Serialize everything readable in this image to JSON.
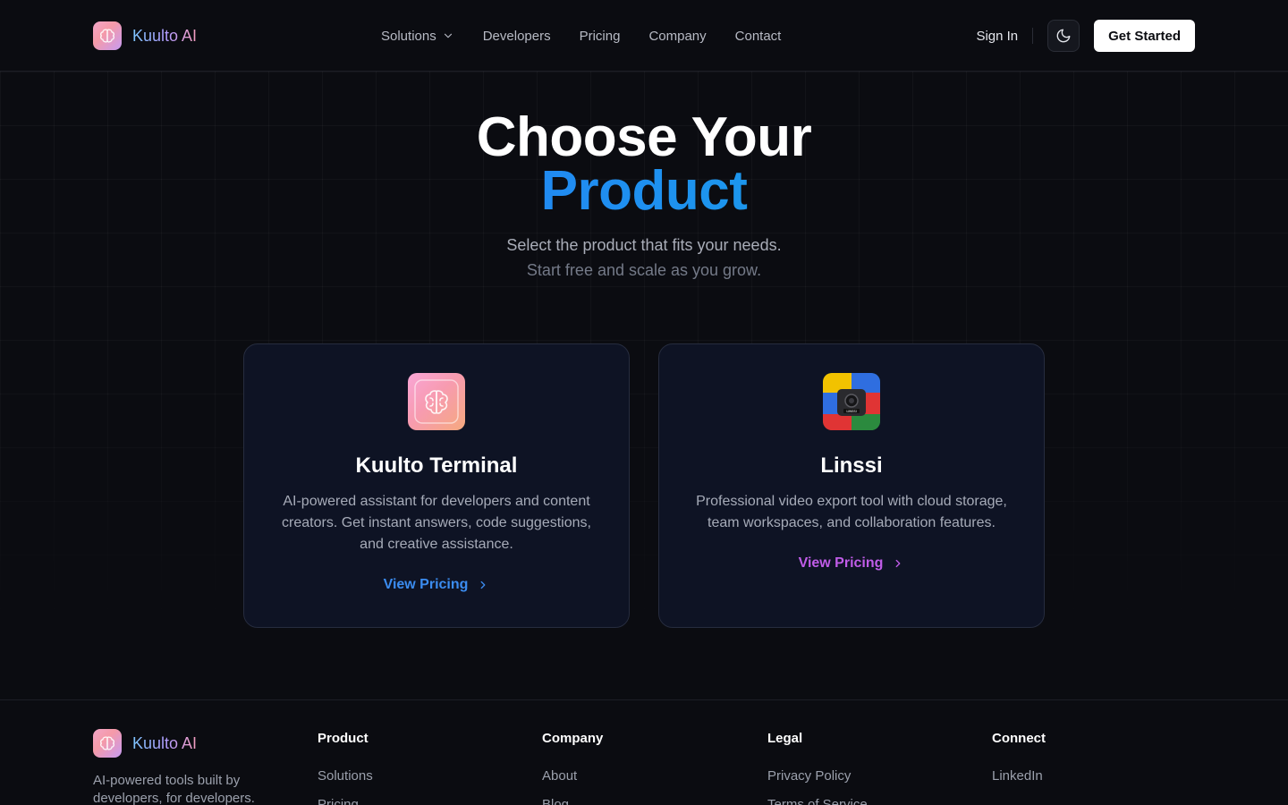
{
  "header": {
    "brand": "Kuulto AI",
    "nav": [
      {
        "label": "Solutions",
        "has_dropdown": true
      },
      {
        "label": "Developers"
      },
      {
        "label": "Pricing"
      },
      {
        "label": "Company"
      },
      {
        "label": "Contact"
      }
    ],
    "sign_in": "Sign In",
    "theme_icon": "moon-icon",
    "cta": "Get Started"
  },
  "hero": {
    "title_line1": "Choose Your",
    "title_line2": "Product",
    "subtitle_line1": "Select the product that fits your needs.",
    "subtitle_line2": "Start free and scale as you grow."
  },
  "products": [
    {
      "name": "Kuulto Terminal",
      "icon": "brain-icon",
      "description": "AI-powered assistant for developers and content creators. Get instant answers, code suggestions, and creative assistance.",
      "link": "View Pricing",
      "accent": "#3b8cf0"
    },
    {
      "name": "Linssi",
      "icon": "camera-icon",
      "icon_badge": "LINSSI",
      "description": "Professional video export tool with cloud storage, team workspaces, and collaboration features.",
      "link": "View Pricing",
      "accent": "#c05ce8"
    }
  ],
  "footer": {
    "brand": "Kuulto AI",
    "tagline": "AI-powered tools built by developers, for developers.",
    "columns": [
      {
        "heading": "Product",
        "links": [
          "Solutions",
          "Pricing"
        ]
      },
      {
        "heading": "Company",
        "links": [
          "About",
          "Blog"
        ]
      },
      {
        "heading": "Legal",
        "links": [
          "Privacy Policy",
          "Terms of Service"
        ]
      },
      {
        "heading": "Connect",
        "links": [
          "LinkedIn"
        ]
      }
    ]
  },
  "colors": {
    "background": "#0b0c11",
    "card_bg": "#0e1324",
    "hero_accent_start": "#2f6df6",
    "hero_accent_end": "#12b5dc"
  }
}
